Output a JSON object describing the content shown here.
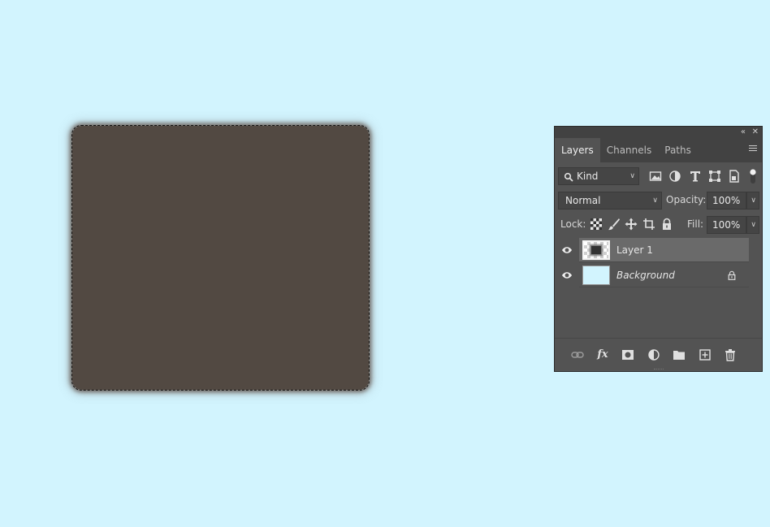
{
  "canvas": {
    "shape_color": "#524942",
    "background_color": "#d2f4fe"
  },
  "panel": {
    "collapse_icon": "double-chevron-left-icon",
    "close_icon": "close-icon",
    "tabs": [
      {
        "label": "Layers",
        "active": true
      },
      {
        "label": "Channels",
        "active": false
      },
      {
        "label": "Paths",
        "active": false
      }
    ],
    "filter": {
      "kind_label": "Kind"
    },
    "blend_mode": "Normal",
    "opacity": {
      "label": "Opacity:",
      "value": "100%"
    },
    "lock": {
      "label": "Lock:"
    },
    "fill": {
      "label": "Fill:",
      "value": "100%"
    },
    "layers": [
      {
        "name": "Layer 1",
        "selected": true,
        "visible": true
      },
      {
        "name": "Background",
        "selected": false,
        "visible": true,
        "locked": true
      }
    ],
    "footer_fx": "fx"
  }
}
